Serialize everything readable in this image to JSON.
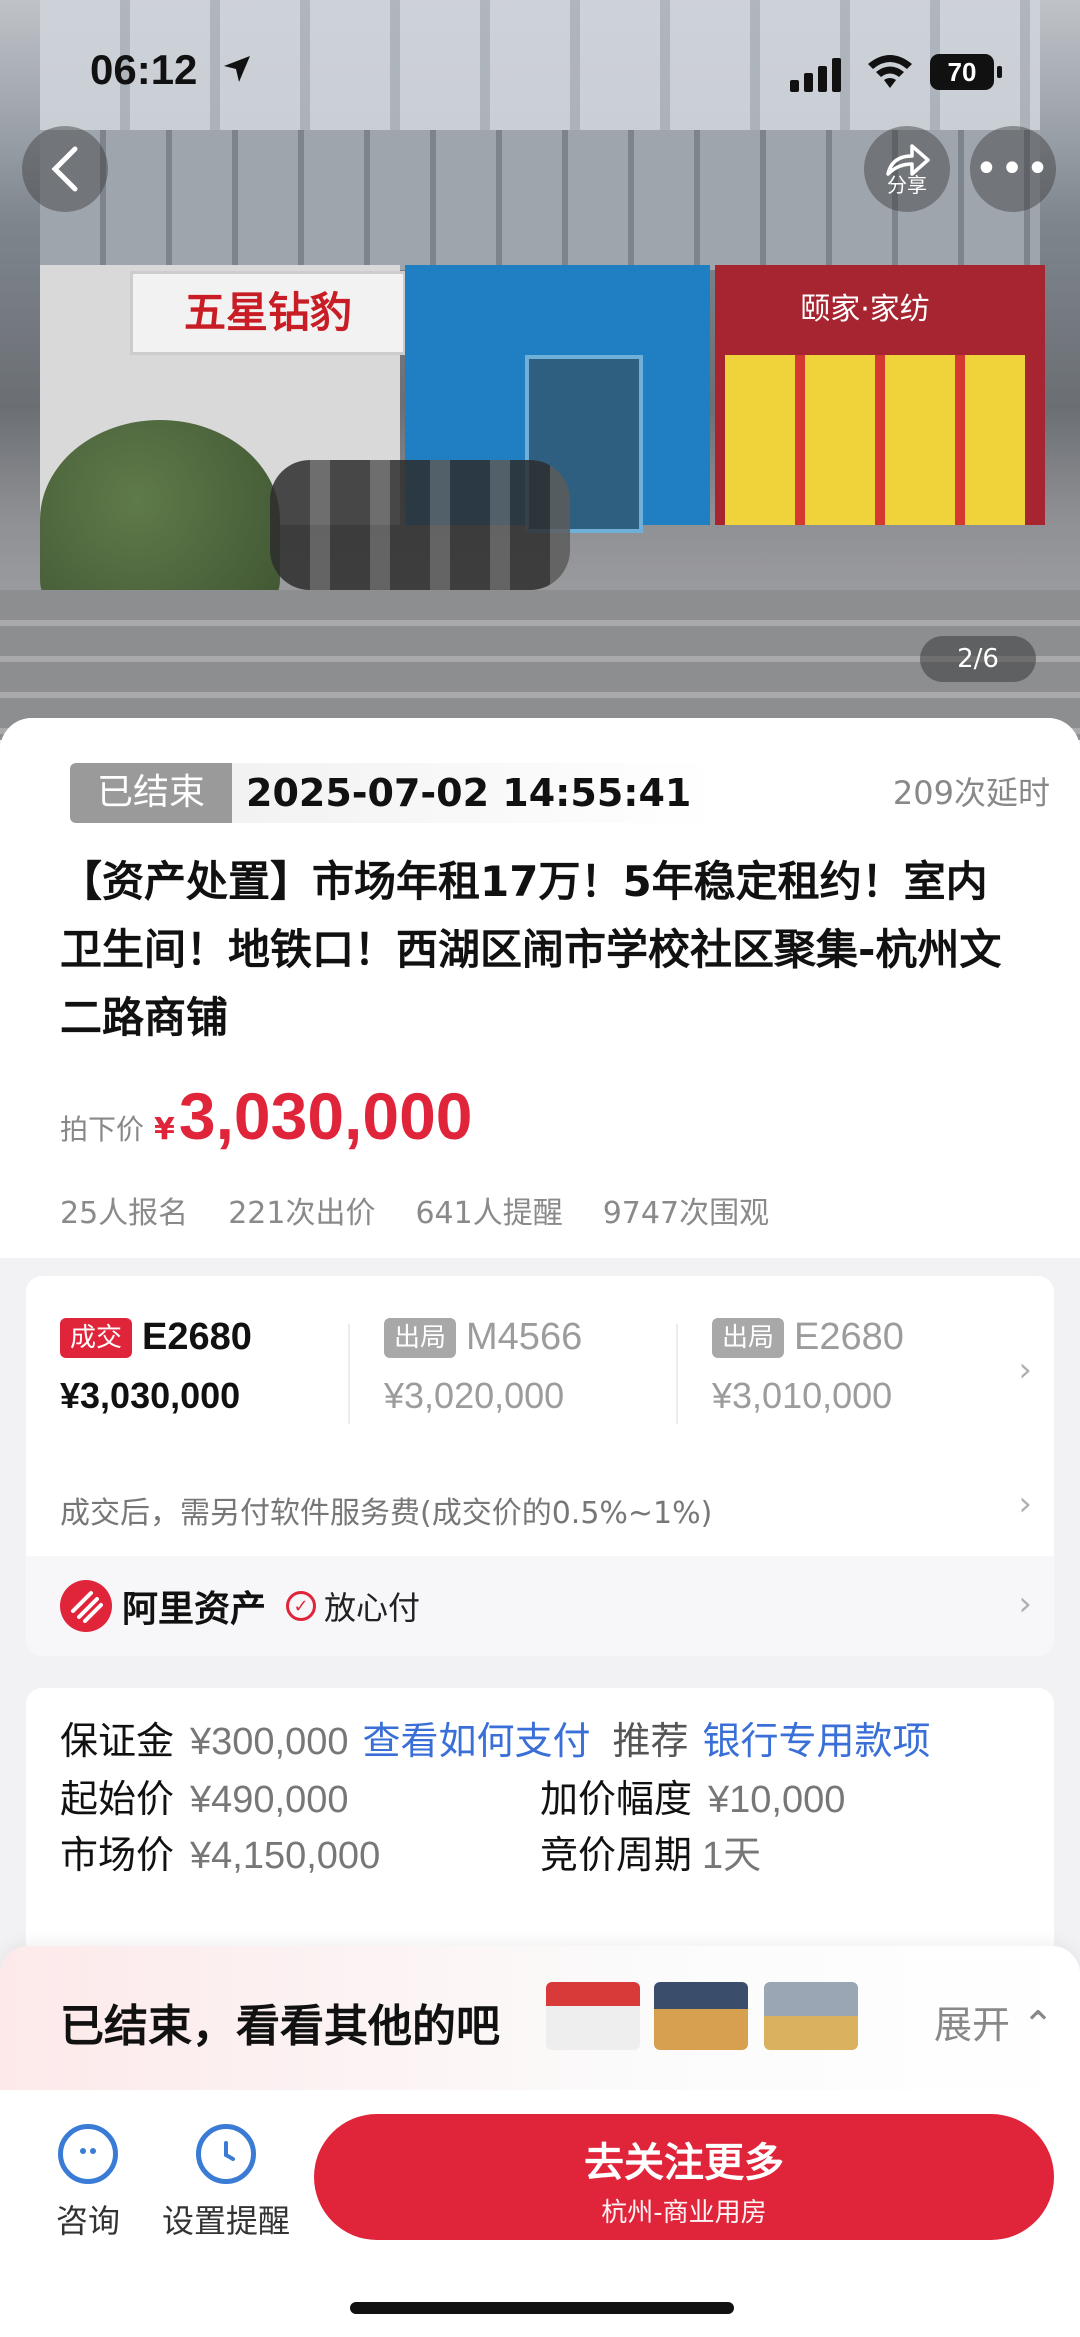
{
  "status_bar": {
    "time": "06:12",
    "battery": "70"
  },
  "hero": {
    "share_label": "分享",
    "counter": "2/6",
    "signs": {
      "left": "五星钻豹",
      "right": "颐家·家纺"
    }
  },
  "auction": {
    "status_tag": "已结束",
    "datetime": "2025-07-02 14:55:41",
    "delay": "209次延时",
    "title": "【资产处置】市场年租17万！5年稳定租约！室内卫生间！地铁口！西湖区闹市学校社区聚集-杭州文二路商铺",
    "price_label": "拍下价",
    "price_symbol": "¥",
    "price_value": "3,030,000",
    "stats": [
      "25人报名",
      "221次出价",
      "641人提醒",
      "9747次围观"
    ]
  },
  "bids": [
    {
      "tag": "成交",
      "id": "E2680",
      "price": "¥3,030,000"
    },
    {
      "tag": "出局",
      "id": "M4566",
      "price": "¥3,020,000"
    },
    {
      "tag": "出局",
      "id": "E2680",
      "price": "¥3,010,000"
    }
  ],
  "fee_note": "成交后，需另付软件服务费(成交价的0.5%~1%)",
  "ali": {
    "name": "阿里资产",
    "badge": "放心付"
  },
  "details": {
    "deposit_label": "保证金",
    "deposit_value": "¥300,000",
    "deposit_link": "查看如何支付",
    "recommend_label": "推荐",
    "recommend_link": "银行专用款项",
    "start_label": "起始价",
    "start_value": "¥490,000",
    "increment_label": "加价幅度",
    "increment_value": "¥10,000",
    "market_label": "市场价",
    "market_value": "¥4,150,000",
    "cycle_label": "竞价周期",
    "cycle_value": "1天"
  },
  "ended_bar": {
    "text": "已结束，看看其他的吧",
    "expand": "展开"
  },
  "bottom": {
    "consult": "咨询",
    "remind": "设置提醒",
    "cta_main": "去关注更多",
    "cta_sub": "杭州-商业用房"
  },
  "colors": {
    "accent": "#e0243a",
    "link": "#3a6fd8"
  },
  "icons": [
    "back-icon",
    "share-icon",
    "more-icon",
    "chevron-right-icon",
    "chevron-up-icon",
    "consult-icon",
    "alarm-icon",
    "check-circle-icon"
  ]
}
